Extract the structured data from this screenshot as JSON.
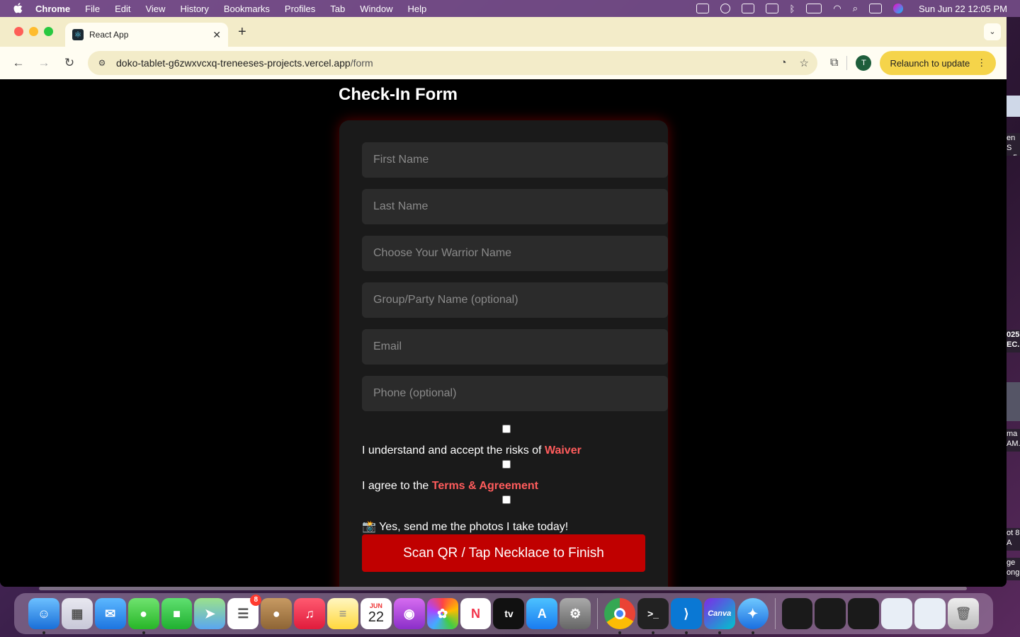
{
  "menubar": {
    "app_name": "Chrome",
    "items": [
      "File",
      "Edit",
      "View",
      "History",
      "Bookmarks",
      "Profiles",
      "Tab",
      "Window",
      "Help"
    ],
    "clock": "Sun Jun 22  12:05 PM"
  },
  "browser": {
    "tab_title": "React App",
    "url_host": "doko-tablet-g6zwxvcxq-treneeses-projects.vercel.app",
    "url_path": "/form",
    "profile_initial": "T",
    "relaunch_label": "Relaunch to update"
  },
  "page": {
    "title": "Check-In Form",
    "fields": {
      "first_name": "First Name",
      "last_name": "Last Name",
      "warrior_name": "Choose Your Warrior Name",
      "group_name": "Group/Party Name (optional)",
      "email": "Email",
      "phone": "Phone (optional)"
    },
    "waiver": {
      "text": "I understand and accept the risks of ",
      "link": "Waiver"
    },
    "terms": {
      "text": "I agree to the ",
      "link": "Terms & Agreement"
    },
    "photos": {
      "text": "📸 Yes, send me the photos I take today!"
    },
    "submit_label": "Scan QR / Tap Necklace to Finish"
  },
  "desktop_snips": {
    "snip1": "en S ...5",
    "snip2": "025 EC.",
    "snip3": "ma AM.",
    "snip4": "ot 8 A",
    "snip5": "ge ong"
  },
  "dock": {
    "reminders_badge": "8",
    "calendar_month": "JUN",
    "calendar_day": "22",
    "tv_label": "tv",
    "canva_label": "Canva"
  }
}
